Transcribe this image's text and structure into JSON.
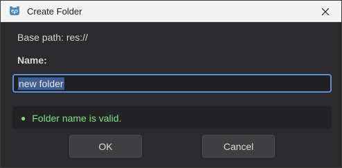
{
  "window": {
    "title": "Create Folder",
    "app_icon": "godot-icon",
    "close_icon": "close-icon"
  },
  "dialog": {
    "base_path": "Base path: res://",
    "name_label": "Name:",
    "name_value": "new folder",
    "validation_message": "Folder name is valid.",
    "ok_label": "OK",
    "cancel_label": "Cancel"
  },
  "colors": {
    "valid": "#7fe07f",
    "focus_border": "#5b8fd6",
    "selection": "#3d5f94"
  }
}
